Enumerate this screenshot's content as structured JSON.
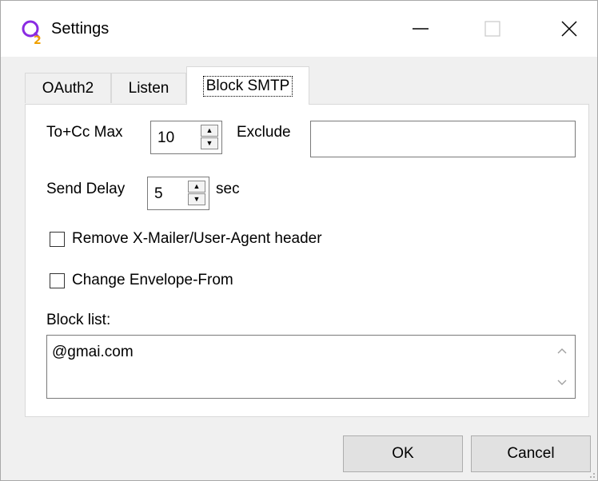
{
  "window": {
    "title": "Settings",
    "icon": "q2-app-icon",
    "controls": [
      "minimize-icon",
      "maximize-icon",
      "close-icon"
    ]
  },
  "tabs": [
    {
      "label": "OAuth2",
      "selected": false
    },
    {
      "label": "Listen",
      "selected": false
    },
    {
      "label": "Block SMTP",
      "selected": true
    }
  ],
  "block_smtp": {
    "to_cc_max_label": "To+Cc Max",
    "to_cc_max_value": "10",
    "exclude_label": "Exclude",
    "exclude_value": "",
    "send_delay_label": "Send Delay",
    "send_delay_value": "5",
    "send_delay_unit": "sec",
    "remove_header_label": "Remove X-Mailer/User-Agent header",
    "remove_header_checked": false,
    "change_envelope_label": "Change Envelope-From",
    "change_envelope_checked": false,
    "block_list_label": "Block list:",
    "block_list_value": "@gmai.com"
  },
  "buttons": {
    "ok": "OK",
    "cancel": "Cancel"
  },
  "colors": {
    "accent": "#8a2be2",
    "accent2": "#f0a000"
  }
}
